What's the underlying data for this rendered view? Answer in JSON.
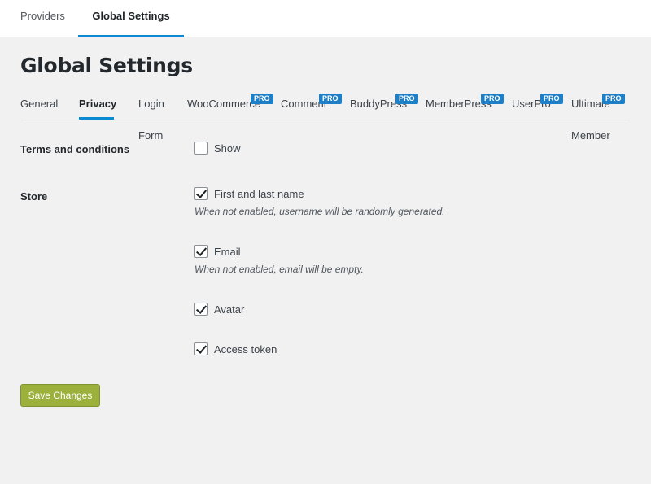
{
  "topnav": {
    "providers": "Providers",
    "global_settings": "Global Settings"
  },
  "page_title": "Global Settings",
  "subtabs": {
    "general": "General",
    "privacy": "Privacy",
    "login": "Login",
    "login_second": "Form",
    "woocommerce": "WooCommerce",
    "comment": "Comment",
    "buddypress": "BuddyPress",
    "memberpress": "MemberPress",
    "userpro": "UserPro",
    "ultimate": "Ultimate",
    "ultimate_second": "Member",
    "pro_badge": "PRO"
  },
  "terms": {
    "label": "Terms and conditions",
    "show": "Show",
    "show_checked": false
  },
  "store": {
    "label": "Store",
    "name": "First and last name",
    "name_desc": "When not enabled, username will be randomly generated.",
    "email": "Email",
    "email_desc": "When not enabled, email will be empty.",
    "avatar": "Avatar",
    "access_token": "Access token"
  },
  "save_label": "Save Changes",
  "colors": {
    "accent": "#0a8ad0",
    "pro_badge": "#1d7fc7",
    "save_button": "#9bb13b"
  }
}
